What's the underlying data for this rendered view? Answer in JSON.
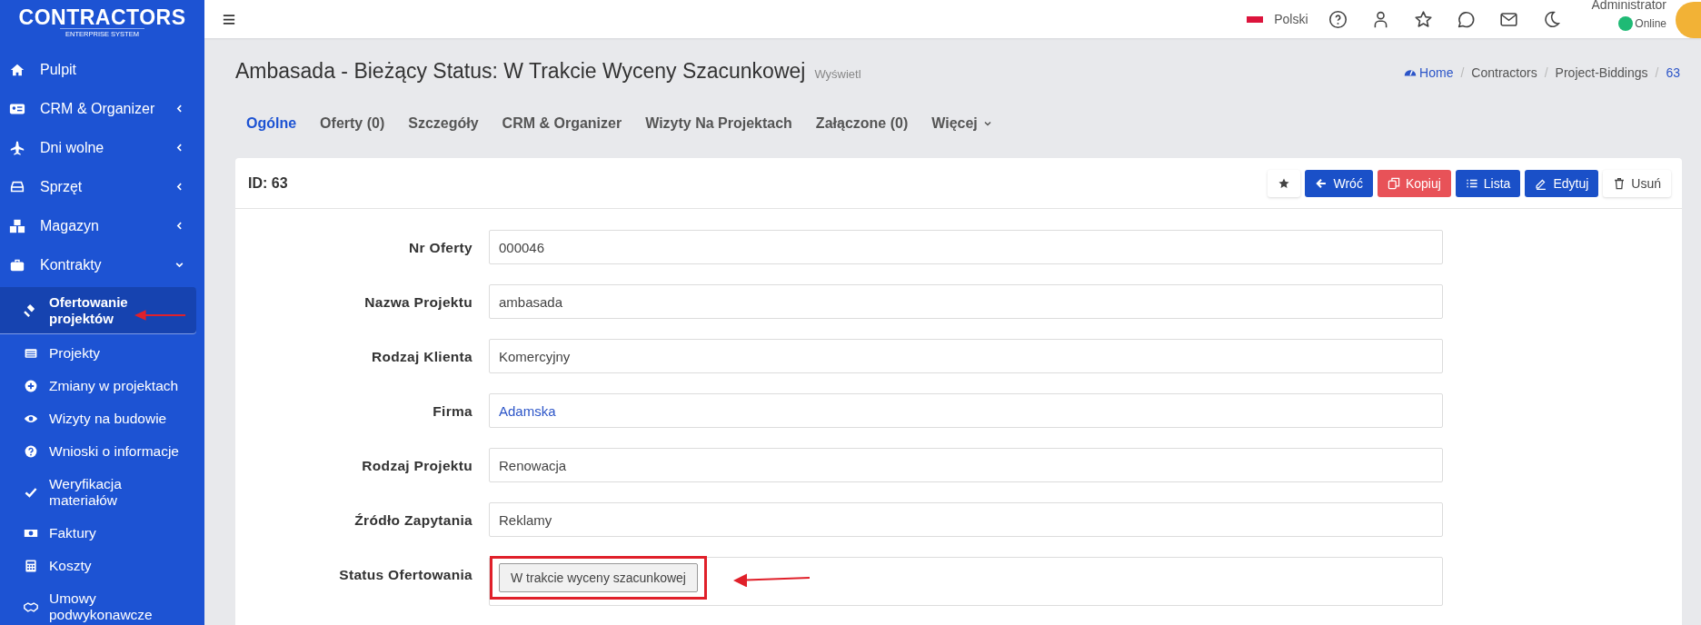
{
  "sidebar": {
    "logo": {
      "title": "CONTRACTORS",
      "subtitle": "ENTERPRISE SYSTEM"
    },
    "items": [
      {
        "label": "Pulpit",
        "kind": "link"
      },
      {
        "label": "CRM & Organizer",
        "kind": "group",
        "expanded": false
      },
      {
        "label": "Dni wolne",
        "kind": "group",
        "expanded": false
      },
      {
        "label": "Sprzęt",
        "kind": "group",
        "expanded": false
      },
      {
        "label": "Magazyn",
        "kind": "group",
        "expanded": false
      },
      {
        "label": "Kontrakty",
        "kind": "group",
        "expanded": true,
        "children": [
          {
            "label": "Ofertowanie projektów",
            "selected": true
          },
          {
            "label": "Projekty",
            "selected": false
          },
          {
            "label": "Zmiany w projektach",
            "selected": false
          },
          {
            "label": "Wizyty na budowie",
            "selected": false
          },
          {
            "label": "Wnioski o informacje",
            "selected": false
          },
          {
            "label": "Weryfikacja materiałów",
            "selected": false
          },
          {
            "label": "Faktury",
            "selected": false
          },
          {
            "label": "Koszty",
            "selected": false
          },
          {
            "label": "Umowy podwykonawcze",
            "selected": false
          }
        ]
      }
    ]
  },
  "topbar": {
    "language": "Polski",
    "user": {
      "name": "Administrator",
      "status": "Online"
    }
  },
  "page": {
    "title": "Ambasada - Bieżący Status: W Trakcie Wyceny Szacunkowej",
    "subtitle": "Wyświetl",
    "breadcrumb": [
      {
        "label": "Home"
      },
      {
        "separator": "/",
        "label": "Contractors"
      },
      {
        "separator": "/",
        "label": "Project-Biddings"
      },
      {
        "separator": "/",
        "label": "63"
      }
    ]
  },
  "tabs": [
    {
      "label": "Ogólne",
      "selected": true,
      "kind": "tab"
    },
    {
      "label": "Oferty (0)",
      "selected": false,
      "kind": "tab"
    },
    {
      "label": "Szczegóły",
      "selected": false,
      "kind": "tab"
    },
    {
      "label": "CRM & Organizer",
      "selected": false,
      "kind": "tab"
    },
    {
      "label": "Wizyty Na Projektach",
      "selected": false,
      "kind": "tab"
    },
    {
      "label": "Załączone (0)",
      "selected": false,
      "kind": "tab"
    },
    {
      "label": "Więcej",
      "selected": false,
      "kind": "dropdown"
    }
  ],
  "card": {
    "title": "ID: 63",
    "buttons": [
      {
        "kind": "light"
      },
      {
        "label": "Wróć",
        "kind": "primary"
      },
      {
        "label": "Kopiuj",
        "kind": "danger"
      },
      {
        "label": "Lista",
        "kind": "primary"
      },
      {
        "label": "Edytuj",
        "kind": "primary"
      },
      {
        "label": "Usuń",
        "kind": "light"
      }
    ],
    "fields": [
      {
        "label": "Nr Oferty",
        "value": "000046",
        "kind": "text"
      },
      {
        "label": "Nazwa Projektu",
        "value": "ambasada",
        "kind": "text"
      },
      {
        "label": "Rodzaj Klienta",
        "value": "Komercyjny",
        "kind": "text"
      },
      {
        "label": "Firma",
        "value": "Adamska",
        "kind": "link"
      },
      {
        "label": "Rodzaj Projektu",
        "value": "Renowacja",
        "kind": "text"
      },
      {
        "label": "Źródło Zapytania",
        "value": "Reklamy",
        "kind": "text"
      },
      {
        "label": "Status Ofertowania",
        "value": "W trakcie wyceny szacunkowej",
        "kind": "button"
      }
    ]
  }
}
